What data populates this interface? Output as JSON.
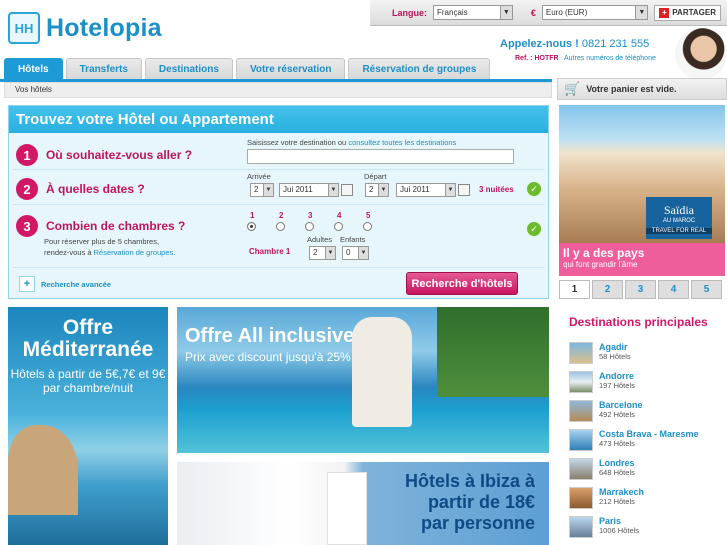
{
  "header": {
    "logo_text": "Hotelopia",
    "logo_mark": "HH",
    "language_label": "Langue:",
    "language_value": "Français",
    "currency_label": "€",
    "currency_value": "Euro (EUR)",
    "share_label": "PARTAGER",
    "phone_label": "Appelez-nous !",
    "phone_number": "0821 231 555",
    "ref_label": "Ref. : HOTFR",
    "other_numbers": "Autres numéros de téléphone"
  },
  "tabs": [
    {
      "label": "Hôtels",
      "active": true
    },
    {
      "label": "Transferts"
    },
    {
      "label": "Destinations"
    },
    {
      "label": "Votre réservation"
    },
    {
      "label": "Réservation de groupes"
    }
  ],
  "breadcrumb": "Vos hôtels",
  "cart_text": "Votre panier est vide.",
  "search": {
    "title": "Trouvez votre Hôtel ou Appartement",
    "step1": {
      "num": "1",
      "question": "Où souhaitez-vous aller ?",
      "hint": "Saisissez votre destination ou",
      "link": "consultez toutes les destinations",
      "value": ""
    },
    "step2": {
      "num": "2",
      "question": "À quelles dates ?",
      "arrival_label": "Arrivée",
      "departure_label": "Départ",
      "arrival_day": "2",
      "arrival_month": "Jui 2011",
      "departure_day": "2",
      "departure_month": "Jui 2011",
      "nights": "3 nuitées"
    },
    "step3": {
      "num": "3",
      "question": "Combien de chambres ?",
      "note1": "Pour réserver plus de 5 chambres,",
      "note2": "rendez-vous à",
      "note_link": "Réservation de groupes.",
      "room_options": [
        "1",
        "2",
        "3",
        "4",
        "5"
      ],
      "room_label": "Chambre 1",
      "adults_label": "Adultes",
      "children_label": "Enfants",
      "adults": "2",
      "children": "0"
    },
    "advanced": "Recherche avancée",
    "submit": "Recherche d'hôtels"
  },
  "promos": {
    "med": {
      "title": "Offre Méditerranée",
      "text": "Hôtels à partir de 5€,7€ et 9€ par chambre/nuit"
    },
    "allinc": {
      "title": "Offre All inclusive",
      "text": "Prix avec discount jusqu'à 25%"
    },
    "ibiza": {
      "line1": "Hôtels à Ibiza à",
      "line2": "partir de 18€",
      "line3": "par personne"
    }
  },
  "slideshow": {
    "brand": "Saïdia",
    "brand_sub": "AU MAROC",
    "tagline": "TRAVEL FOR REAL",
    "caption_title": "Il y a des pays",
    "caption_text": "qui font grandir l'âme",
    "pages": [
      "1",
      "2",
      "3",
      "4",
      "5"
    ]
  },
  "destinations": {
    "title": "Destinations principales",
    "items": [
      {
        "name": "Agadir",
        "count": "58 Hôtels"
      },
      {
        "name": "Andorre",
        "count": "197 Hôtels"
      },
      {
        "name": "Barcelone",
        "count": "492 Hôtels"
      },
      {
        "name": "Costa Brava - Maresme",
        "count": "473 Hôtels"
      },
      {
        "name": "Londres",
        "count": "648 Hôtels"
      },
      {
        "name": "Marrakech",
        "count": "212 Hôtels"
      },
      {
        "name": "Paris",
        "count": "1006 Hôtels"
      }
    ]
  }
}
